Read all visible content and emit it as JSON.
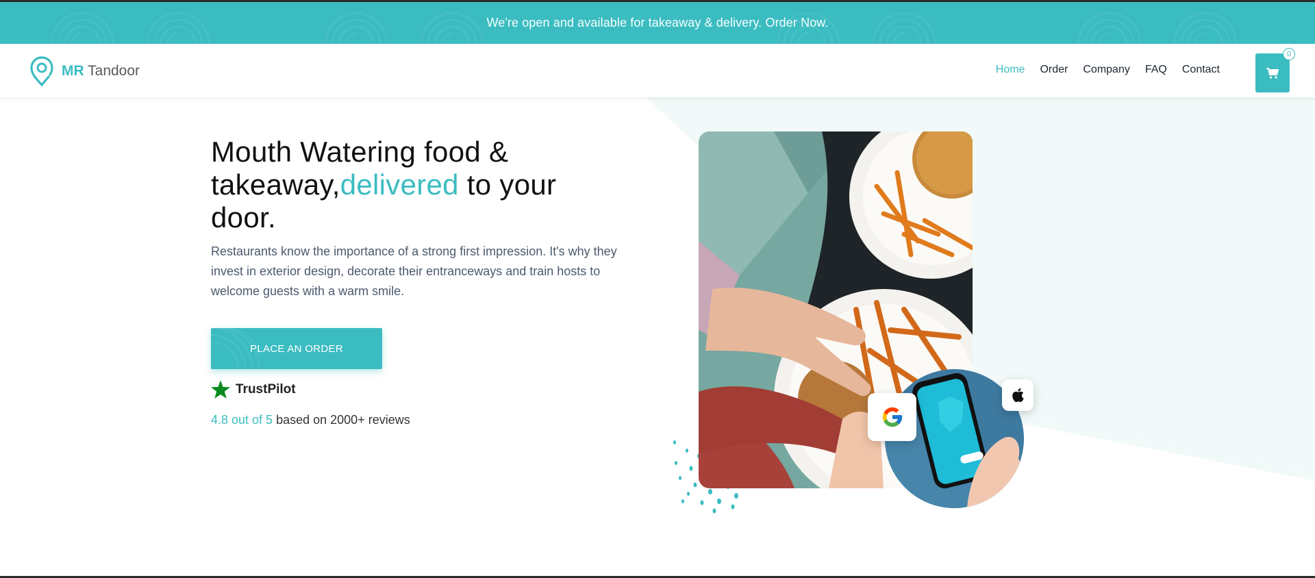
{
  "announcement": {
    "text": "We're open and available for takeaway & delivery. Order Now."
  },
  "brand": {
    "mr": "MR",
    "name": "Tandoor",
    "accent_color": "#3bbcc1"
  },
  "nav": {
    "items": [
      {
        "label": "Home",
        "active": true
      },
      {
        "label": "Order",
        "active": false
      },
      {
        "label": "Company",
        "active": false
      },
      {
        "label": "FAQ",
        "active": false
      },
      {
        "label": "Contact",
        "active": false
      }
    ],
    "cart": {
      "icon": "cart-icon",
      "count": "0"
    }
  },
  "hero": {
    "title_line1": "Mouth Watering food &",
    "title_line2_pre": "takeaway,",
    "title_accent": "delivered",
    "title_line2_post": " to your",
    "title_line3": "door.",
    "description": "Restaurants know the importance of a strong first impression. It's why they invest in exterior design, decorate their entranceways and train hosts to welcome guests with a warm smile.",
    "cta_label": "PLACE AN ORDER"
  },
  "trust": {
    "icon": "star-icon",
    "name": "TrustPilot",
    "rating_highlight": "4.8 out of 5",
    "rating_rest": " based on 2000+ reviews"
  },
  "app_badges": {
    "google_icon": "google-icon",
    "apple_icon": "apple-icon"
  }
}
